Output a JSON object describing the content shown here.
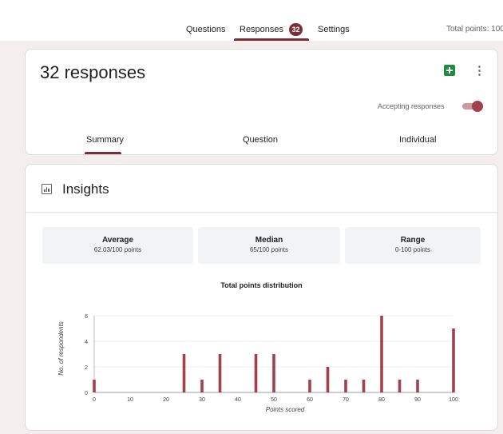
{
  "nav": {
    "tabs": [
      {
        "label": "Questions"
      },
      {
        "label": "Responses",
        "badge": "32",
        "active": true
      },
      {
        "label": "Settings"
      }
    ],
    "total_points": "Total points: 100"
  },
  "summary_card": {
    "title": "32 responses",
    "accepting_label": "Accepting responses",
    "accepting": true,
    "tabs": [
      {
        "label": "Summary",
        "active": true
      },
      {
        "label": "Question"
      },
      {
        "label": "Individual"
      }
    ]
  },
  "insights": {
    "title": "Insights",
    "stats": [
      {
        "label": "Average",
        "value": "62.03/100 points"
      },
      {
        "label": "Median",
        "value": "65/100 points"
      },
      {
        "label": "Range",
        "value": "0-100 points"
      }
    ]
  },
  "colors": {
    "accent": "#7a2e37",
    "bar": "#a3404d",
    "canvas": "#f5eeef",
    "sheets": "#1e8e3e"
  },
  "icons": {
    "sheets": "google-sheets-icon",
    "more": "more-vert-icon",
    "insights": "bar-chart-icon"
  },
  "chart_data": {
    "type": "bar",
    "title": "Total points distribution",
    "xlabel": "Points scored",
    "ylabel": "No. of respondents",
    "x": [
      0,
      25,
      30,
      35,
      45,
      50,
      60,
      65,
      70,
      75,
      80,
      85,
      90,
      100
    ],
    "values": [
      1,
      3,
      1,
      3,
      3,
      3,
      1,
      2,
      1,
      1,
      6,
      1,
      1,
      5
    ],
    "xlim": [
      0,
      100
    ],
    "ylim": [
      0,
      6
    ],
    "xticks": [
      "0",
      "10",
      "20",
      "30",
      "40",
      "50",
      "60",
      "70",
      "80",
      "90",
      "100"
    ],
    "yticks": [
      "0",
      "2",
      "4",
      "6"
    ],
    "grid": true
  }
}
